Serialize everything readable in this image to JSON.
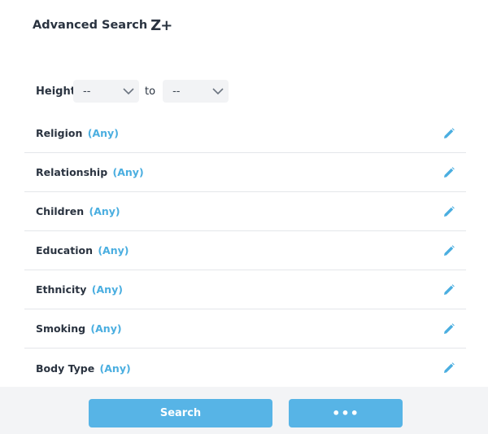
{
  "header": {
    "title": "Advanced Search",
    "badge": "Z+"
  },
  "height": {
    "label": "Height",
    "from_value": "--",
    "to_label": "to",
    "to_value": "--"
  },
  "filters": [
    {
      "label": "Religion",
      "value": "(Any)"
    },
    {
      "label": "Relationship",
      "value": "(Any)"
    },
    {
      "label": "Children",
      "value": "(Any)"
    },
    {
      "label": "Education",
      "value": "(Any)"
    },
    {
      "label": "Ethnicity",
      "value": "(Any)"
    },
    {
      "label": "Smoking",
      "value": "(Any)"
    },
    {
      "label": "Body Type",
      "value": "(Any)"
    }
  ],
  "footer": {
    "search_label": "Search",
    "more_label": "•••"
  },
  "icons": {
    "edit": "pencil-icon",
    "dropdown": "chevron-down-icon"
  },
  "colors": {
    "accent": "#4aaee0",
    "button": "#57b4e6",
    "text": "#2a3340",
    "footer_bg": "#f3f4f6"
  }
}
